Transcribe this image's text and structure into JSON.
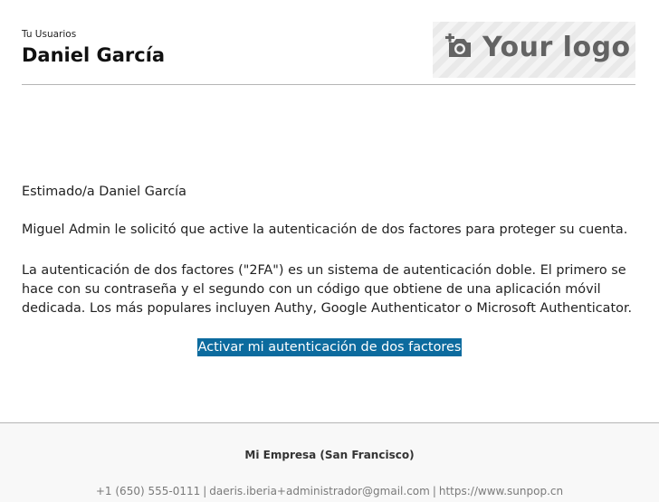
{
  "header": {
    "kicker": "Tu Usuarios",
    "user_name": "Daniel García",
    "logo": {
      "icon": "camera-plus-icon",
      "text": "Your logo"
    }
  },
  "message": {
    "greeting": "Estimado/a Daniel García",
    "paragraph_1": "Miguel Admin le solicitó que active la autenticación de dos factores para proteger su cuenta.",
    "paragraph_2": "La autenticación de dos factores (\"2FA\") es un sistema de autenticación doble. El primero se hace con su contraseña y el segundo con un código que obtiene de una aplicación móvil dedicada. Los más populares incluyen Authy, Google Authenticator o Microsoft Authenticator.",
    "cta_label": "Activar mi autenticación de dos factores"
  },
  "footer": {
    "company": "Mi Empresa (San Francisco)",
    "phone": "+1 (650) 555-0111",
    "email": "daeris.iberia+administrador@gmail.com",
    "website": "https://www.sunpop.cn",
    "separator": "|"
  },
  "colors": {
    "cta_background": "#0c6b9e",
    "cta_text": "#ffffff",
    "footer_text": "#7a7a7a"
  }
}
